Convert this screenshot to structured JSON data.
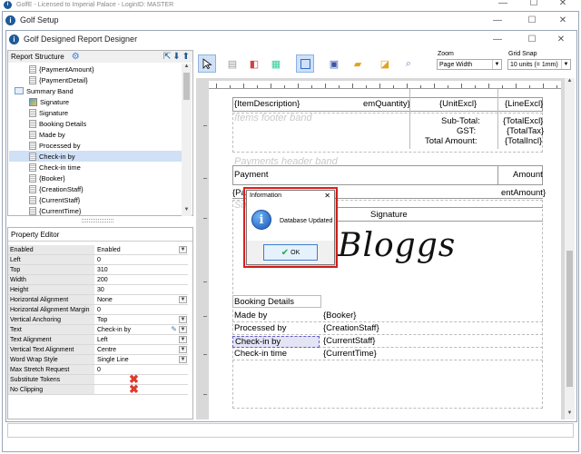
{
  "outer_window": {
    "title": "GolfE - Licensed to Imperial Palace - LoginID: MASTER"
  },
  "setup_window": {
    "title": "Golf Setup"
  },
  "designer_window": {
    "title": "Golf Designed Report Designer"
  },
  "window_controls": {
    "minimize": "—",
    "maximize": "☐",
    "close": "✕"
  },
  "report_structure": {
    "title": "Report Structure",
    "items": [
      {
        "label": "{PaymentAmount}",
        "icon": "doc-icon",
        "indent": 2,
        "selected": false
      },
      {
        "label": "{PaymentDetail}",
        "icon": "doc-icon",
        "indent": 2,
        "selected": false
      },
      {
        "label": "Summary Band",
        "icon": "band-icon",
        "indent": 1,
        "selected": false
      },
      {
        "label": "Signature",
        "icon": "signature-image-icon",
        "indent": 2,
        "selected": false
      },
      {
        "label": "Signature",
        "icon": "doc-icon",
        "indent": 2,
        "selected": false
      },
      {
        "label": "Booking Details",
        "icon": "doc-icon",
        "indent": 2,
        "selected": false
      },
      {
        "label": "Made by",
        "icon": "doc-icon",
        "indent": 2,
        "selected": false
      },
      {
        "label": "Processed by",
        "icon": "doc-icon",
        "indent": 2,
        "selected": false
      },
      {
        "label": "Check-in by",
        "icon": "doc-icon",
        "indent": 2,
        "selected": true
      },
      {
        "label": "Check-in time",
        "icon": "doc-icon",
        "indent": 2,
        "selected": false
      },
      {
        "label": "{Booker}",
        "icon": "doc-icon",
        "indent": 2,
        "selected": false
      },
      {
        "label": "{CreationStaff}",
        "icon": "doc-icon",
        "indent": 2,
        "selected": false
      },
      {
        "label": "{CurrentStaff}",
        "icon": "doc-icon",
        "indent": 2,
        "selected": false
      },
      {
        "label": "{CurrentTime}",
        "icon": "doc-icon",
        "indent": 2,
        "selected": false
      }
    ]
  },
  "property_editor": {
    "title": "Property Editor",
    "rows": [
      {
        "name": "Enabled",
        "value": "Enabled",
        "dropdown": true
      },
      {
        "name": "Left",
        "value": "0"
      },
      {
        "name": "Top",
        "value": "310"
      },
      {
        "name": "Width",
        "value": "200"
      },
      {
        "name": "Height",
        "value": "30"
      },
      {
        "name": "Horizontal Alignment",
        "value": "None",
        "dropdown": true
      },
      {
        "name": "Horizontal Alignment Margin",
        "value": "0"
      },
      {
        "name": "Vertical Anchoring",
        "value": "Top",
        "dropdown": true
      },
      {
        "name": "Text",
        "value": "Check-in by",
        "dropdown": true,
        "edit": true
      },
      {
        "name": "Text Alignment",
        "value": "Left",
        "dropdown": true
      },
      {
        "name": "Vertical Text Alignment",
        "value": "Centre",
        "dropdown": true
      },
      {
        "name": "Word Wrap Style",
        "value": "Single Line",
        "dropdown": true
      },
      {
        "name": "Max Stretch Request",
        "value": "0"
      },
      {
        "name": "Substitute Tokens",
        "value": "",
        "red_x": true
      },
      {
        "name": "No Clipping",
        "value": "",
        "red_x": true
      }
    ]
  },
  "toolbar": {
    "zoom_label": "Zoom",
    "zoom_value": "Page Width",
    "grid_snap_label": "Grid Snap",
    "grid_snap_value": "10 units (= 1mm)"
  },
  "report": {
    "header_cells": [
      "{ItemDescription}",
      "emQuantity}",
      "{UnitExcl}",
      "{LineExcl}"
    ],
    "items_footer_label": "Items footer band",
    "totals": [
      {
        "label": "Sub-Total:",
        "value": "{TotalExcl}"
      },
      {
        "label": "GST:",
        "value": "{TotalTax}"
      },
      {
        "label": "Total Amount:",
        "value": "{TotalIncl}"
      }
    ],
    "payments_header_label": "Payments header band",
    "payment_col": "Payment",
    "amount_col": "Amount",
    "payment_detail_prefix": "{Pa",
    "payment_amount_suffix": "entAmount}",
    "summary_label_fragment": "Su",
    "signature_label": "Signature",
    "signature_text": "Bloggs",
    "booking_details": "Booking Details",
    "detail_rows": [
      {
        "label": "Made by",
        "value": "{Booker}"
      },
      {
        "label": "Processed by",
        "value": "{CreationStaff}"
      },
      {
        "label": "Check-in by",
        "value": "{CurrentStaff}"
      },
      {
        "label": "Check-in time",
        "value": "{CurrentTime}"
      }
    ]
  },
  "dialog": {
    "title": "Information",
    "message": "Database Updated",
    "ok": "OK",
    "close": "✕"
  },
  "colors": {
    "dialog_highlight": "#e0201b",
    "selection": "#cfe0f7",
    "accent": "#1e5a99",
    "red_x": "#e03a2e"
  }
}
